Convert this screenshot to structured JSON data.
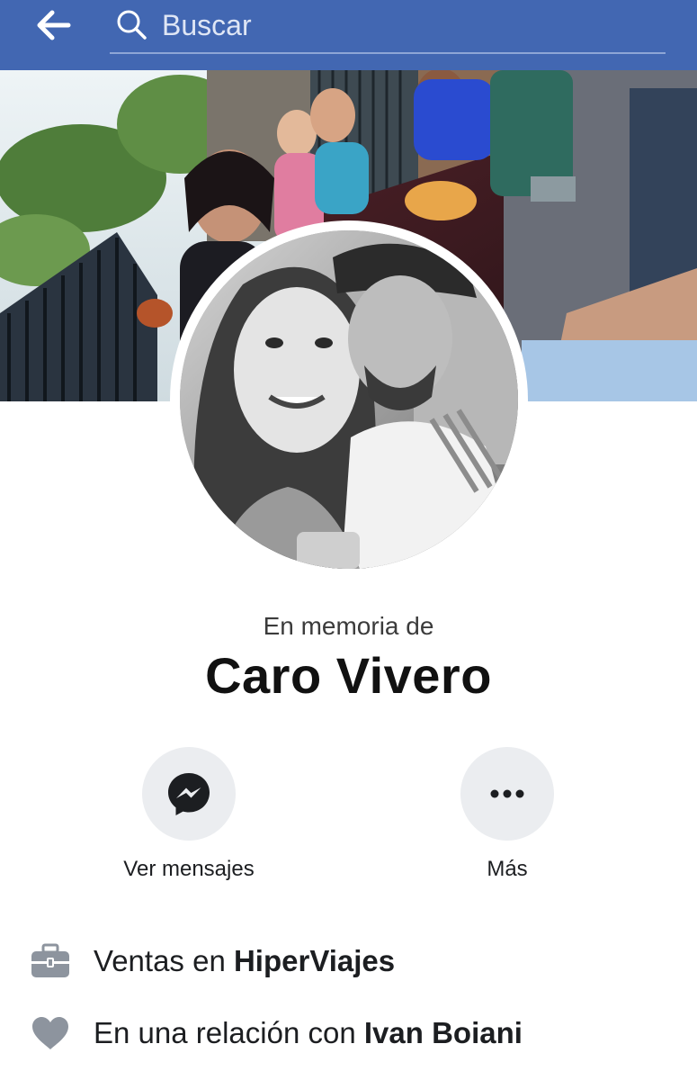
{
  "header": {
    "back_icon": "arrow-left-icon",
    "search_icon": "search-icon",
    "search_placeholder": "Buscar",
    "background_color": "#4267b2"
  },
  "profile": {
    "memorial_text": "En memoria de",
    "name": "Caro Vivero"
  },
  "actions": [
    {
      "label": "Ver mensajes",
      "icon": "messenger-icon"
    },
    {
      "label": "Más",
      "icon": "more-dots-icon"
    }
  ],
  "info": {
    "work": {
      "icon": "briefcase-icon",
      "prefix": "Ventas en ",
      "highlight": "HiperViajes"
    },
    "relationship": {
      "icon": "heart-icon",
      "prefix": "En una relación con ",
      "highlight": "Ivan Boiani"
    }
  }
}
